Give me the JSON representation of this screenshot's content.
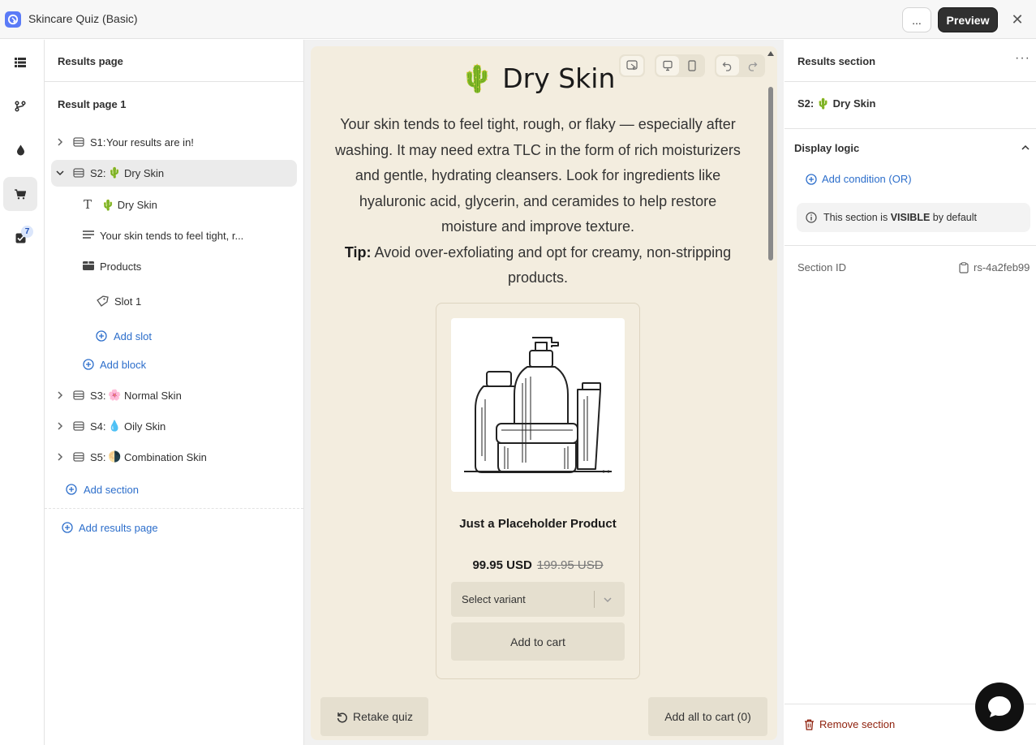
{
  "app": {
    "title": "Skincare Quiz (Basic)",
    "more_label": "...",
    "preview_label": "Preview",
    "close_symbol": "✕"
  },
  "rail": {
    "badge_count": "7"
  },
  "left": {
    "header": "Results page",
    "page_title": "Result page 1",
    "sections": [
      {
        "code": "S1:",
        "emoji": "",
        "label": "Your results are in!"
      },
      {
        "code": "S2:",
        "emoji": "🌵",
        "label": "Dry Skin"
      },
      {
        "code": "S3:",
        "emoji": "🌸",
        "label": "Normal Skin"
      },
      {
        "code": "S4:",
        "emoji": "💧",
        "label": "Oily Skin"
      },
      {
        "code": "S5:",
        "emoji": "🌗",
        "label": "Combination Skin"
      }
    ],
    "blocks": {
      "heading": "🌵 Dry Skin",
      "text": "Your skin tends to feel tight, r...",
      "products": "Products",
      "slot": "Slot 1",
      "add_slot": "Add slot",
      "add_block": "Add block"
    },
    "add_section": "Add section",
    "add_results_page": "Add results page"
  },
  "preview": {
    "heading": "🌵 Dry Skin",
    "description": "Your skin tends to feel tight, rough, or flaky — especially after washing. It may need extra TLC in the form of rich moisturizers and gentle, hydrating cleansers. Look for ingredients like hyaluronic acid, glycerin, and ceramides to help restore moisture and improve texture.",
    "tip_label": "Tip:",
    "tip_text": "Avoid over-exfoliating and opt for creamy, non-stripping products.",
    "product": {
      "name": "Just a Placeholder Product",
      "price": "99.95 USD",
      "compare_price": "199.95 USD",
      "variant_placeholder": "Select variant",
      "add_to_cart": "Add to cart"
    },
    "retake_label": "Retake quiz",
    "add_all_label": "Add all to cart (0)"
  },
  "right": {
    "header": "Results section",
    "section_code": "S2:",
    "section_emoji": "🌵",
    "section_label": "Dry Skin",
    "display_logic": "Display logic",
    "add_condition": "Add condition (OR)",
    "visible_prefix": "This section is",
    "visible_word": "VISIBLE",
    "visible_suffix": "by default",
    "section_id_label": "Section ID",
    "section_id_value": "rs-4a2feb99",
    "remove_label": "Remove section"
  },
  "colors": {
    "accent": "#2c6ecb",
    "canvas_bg": "#f3eddf",
    "danger": "#8e1f0b",
    "primary_button": "#303030"
  }
}
